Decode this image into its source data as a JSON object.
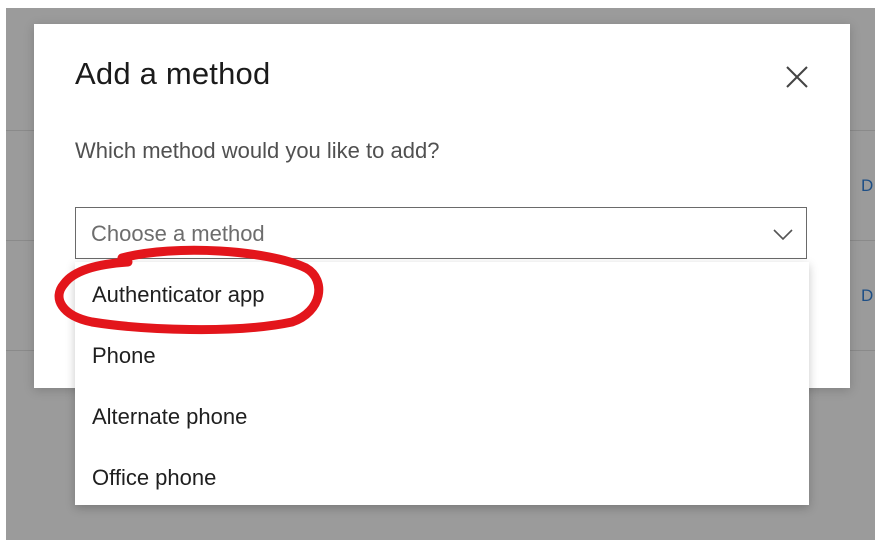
{
  "background": {
    "edge_link_letters": [
      "D",
      "D"
    ]
  },
  "dialog": {
    "title": "Add a method",
    "close_icon": "close-icon",
    "question": "Which method would you like to add?",
    "select": {
      "placeholder": "Choose a method",
      "icon": "chevron-down-icon",
      "options": [
        "Authenticator app",
        "Phone",
        "Alternate phone",
        "Office phone"
      ]
    }
  },
  "colors": {
    "annotation_circle": "#e3151b",
    "backdrop": "#9b9b9b",
    "edge_link": "#1e4f86"
  }
}
